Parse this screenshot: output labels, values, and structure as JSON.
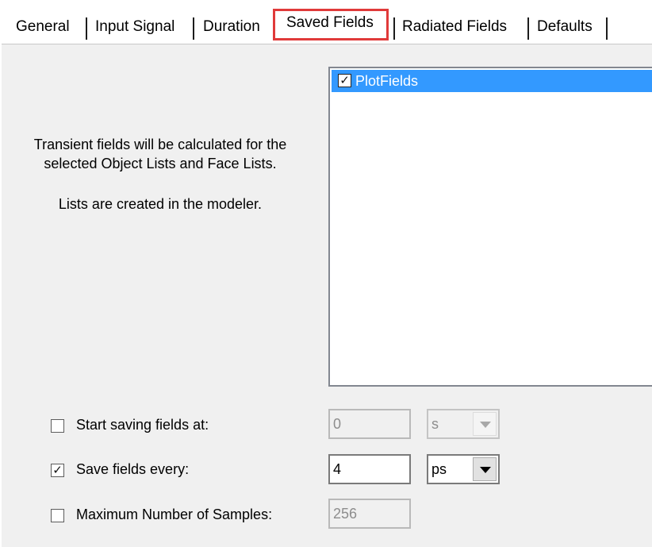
{
  "tabs": [
    {
      "label": "General"
    },
    {
      "label": "Input Signal"
    },
    {
      "label": "Duration"
    },
    {
      "label": "Saved Fields",
      "active": true
    },
    {
      "label": "Radiated Fields"
    },
    {
      "label": "Defaults"
    }
  ],
  "description": {
    "line1": "Transient fields will be calculated for the",
    "line2": "selected Object Lists and Face Lists.",
    "line3": "Lists are created in the modeler."
  },
  "field_lists": {
    "items": [
      {
        "label": "PlotFields",
        "checked": true,
        "selected": true
      }
    ]
  },
  "start_saving": {
    "label": "Start saving fields at:",
    "checked": false,
    "value": "0",
    "unit": "s",
    "enabled": false
  },
  "save_every": {
    "label": "Save fields every:",
    "checked": true,
    "value": "4",
    "unit": "ps",
    "enabled": true
  },
  "max_samples": {
    "label": "Maximum Number of Samples:",
    "checked": false,
    "value": "256",
    "enabled": false
  },
  "colors": {
    "selection": "#3399ff",
    "highlight_outline": "#e03a3a",
    "panel": "#f0f0f0"
  },
  "icons": {
    "check": "checkmark-icon",
    "dropdown": "chevron-down-icon"
  }
}
